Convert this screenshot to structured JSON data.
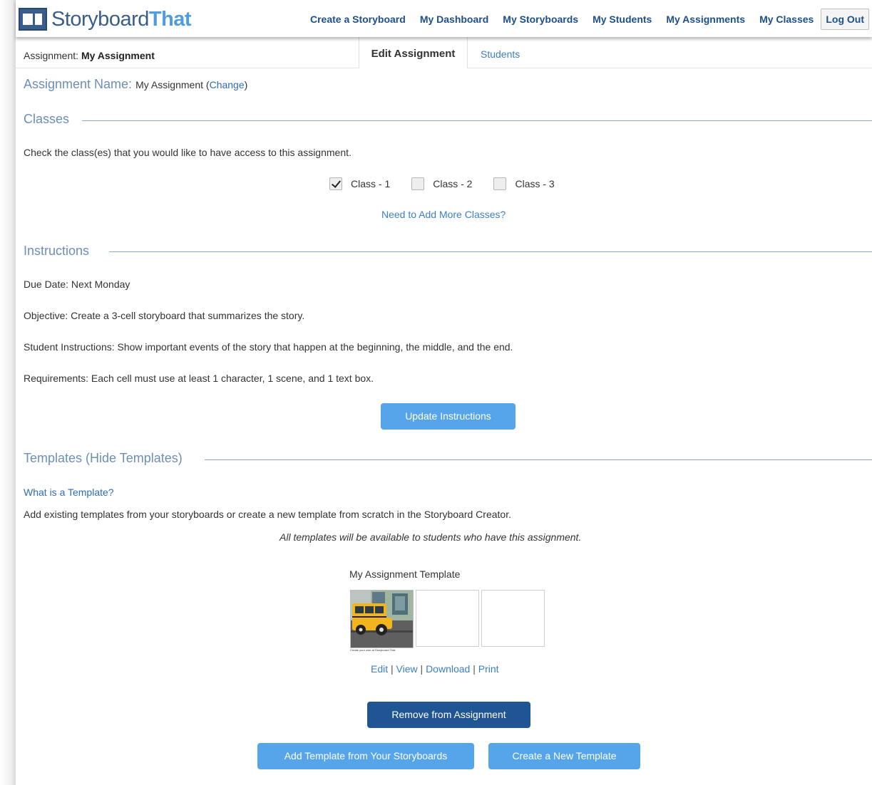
{
  "header": {
    "logo_word_1": "Storyboard",
    "logo_word_2": "That",
    "nav": [
      "Create a Storyboard",
      "My Dashboard",
      "My Storyboards",
      "My Students",
      "My Assignments",
      "My Classes"
    ],
    "logout_label": "Log Out"
  },
  "subheader": {
    "assignment_prefix": "Assignment:",
    "assignment_value": "My Assignment",
    "tab_edit": "Edit Assignment",
    "tab_students": "Students"
  },
  "assignment_name": {
    "label": "Assignment Name:",
    "value": "My Assignment",
    "open_paren": "(",
    "change_link": "Change",
    "close_paren": ")"
  },
  "classes": {
    "title": "Classes",
    "prompt": "Check the class(es) that you would like to have access to this assignment.",
    "items": [
      {
        "label": "Class - 1",
        "checked": true
      },
      {
        "label": "Class - 2",
        "checked": false
      },
      {
        "label": "Class - 3",
        "checked": false
      }
    ],
    "add_more_link": "Need to Add More Classes?"
  },
  "instructions": {
    "title": "Instructions",
    "lines": [
      "Due Date: Next Monday",
      "Objective: Create a 3-cell storyboard that summarizes the story.",
      "Student Instructions: Show important events of the story that happen at the beginning, the middle, and the end.",
      "Requirements: Each cell must use at least 1 character, 1 scene, and 1 text box."
    ],
    "update_button": "Update Instructions"
  },
  "templates": {
    "title": "Templates (Hide Templates)",
    "what_link": "What is a Template?",
    "description": "Add existing templates from your storyboards or create a new template from scratch in the Storyboard Creator.",
    "note": "All templates will be available to students who have this assignment.",
    "template_name": "My Assignment Template",
    "thumb_caption": "Create your own at Storyboard That",
    "actions": {
      "edit": "Edit",
      "view": "View",
      "download": "Download",
      "print": "Print",
      "separator": "|"
    },
    "remove_button": "Remove from Assignment",
    "add_from_button": "Add Template from Your Storyboards",
    "create_button": "Create a New Template"
  },
  "colors": {
    "accent": "#56a5ea",
    "dark_button": "#1f5592",
    "link": "#2f6db5",
    "heading": "#6d8fb5"
  }
}
